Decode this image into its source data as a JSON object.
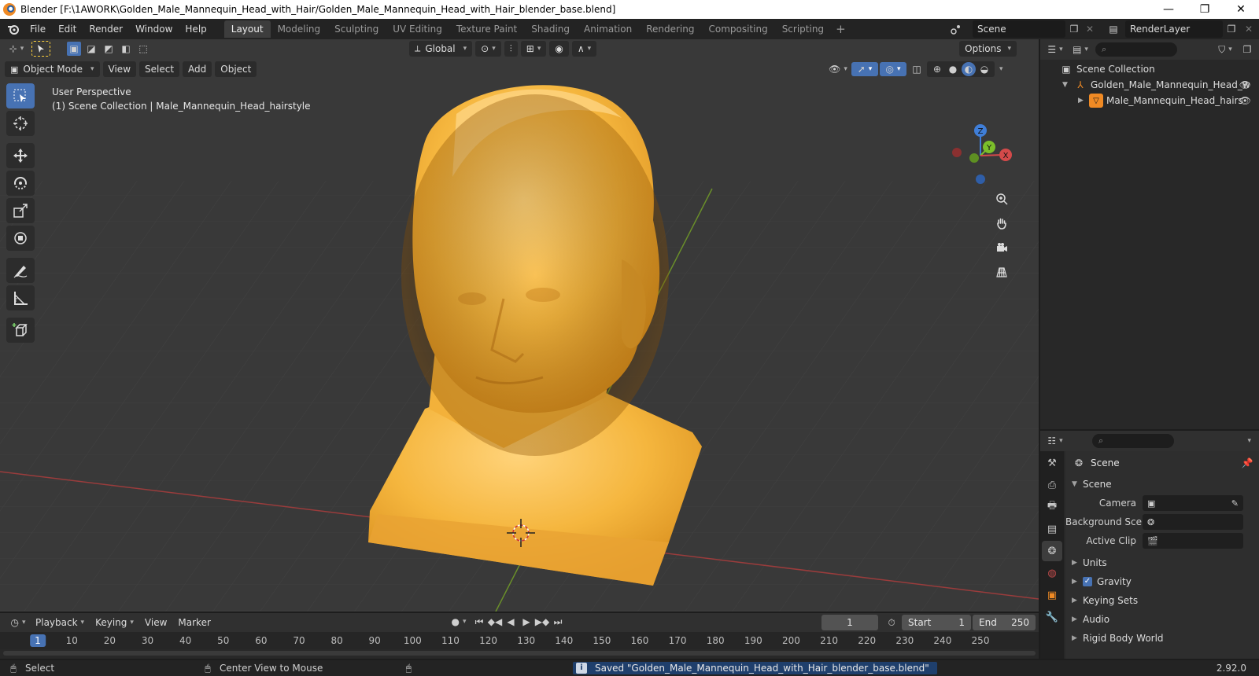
{
  "window": {
    "title": "Blender [F:\\1AWORK\\Golden_Male_Mannequin_Head_with_Hair/Golden_Male_Mannequin_Head_with_Hair_blender_base.blend]",
    "minimize": "—",
    "restore": "❐",
    "close": "✕"
  },
  "topbar": {
    "menus": [
      "File",
      "Edit",
      "Render",
      "Window",
      "Help"
    ],
    "workspaces": [
      "Layout",
      "Modeling",
      "Sculpting",
      "UV Editing",
      "Texture Paint",
      "Shading",
      "Animation",
      "Rendering",
      "Compositing",
      "Scripting"
    ],
    "active_workspace": "Layout",
    "add_workspace": "+",
    "scene_name": "Scene",
    "view_layer": "RenderLayer"
  },
  "viewport": {
    "mode": "Object Mode",
    "menus": [
      "View",
      "Select",
      "Add",
      "Object"
    ],
    "transform_orientation": "Global",
    "options_label": "Options",
    "perspective": "User Perspective",
    "collection_info": "(1) Scene Collection | Male_Mannequin_Head_hairstyle",
    "gizmo": {
      "z": "Z",
      "y": "Y",
      "x": "X"
    },
    "colors": {
      "background": "#393939",
      "x_axis": "#d44a4a",
      "y_axis": "#7bbf2a",
      "mesh": "#f2b43c",
      "selection": "#4772b3"
    }
  },
  "outliner": {
    "search_placeholder": "⌕",
    "root": "Scene Collection",
    "items": [
      {
        "label": "Golden_Male_Mannequin_Head_w"
      },
      {
        "label": "Male_Mannequin_Head_hairs"
      }
    ]
  },
  "properties": {
    "search_placeholder": "⌕",
    "context": "Scene",
    "scene_panel": "Scene",
    "fields": [
      {
        "label": "Camera",
        "value": ""
      },
      {
        "label": "Background Sce...",
        "value": ""
      },
      {
        "label": "Active Clip",
        "value": ""
      }
    ],
    "panels": [
      "Units",
      "Gravity",
      "Keying Sets",
      "Audio",
      "Rigid Body World"
    ],
    "gravity_checked": "✓"
  },
  "timeline": {
    "menus": [
      "Playback",
      "Keying",
      "View",
      "Marker"
    ],
    "current_frame": "1",
    "start_label": "Start",
    "start": "1",
    "end_label": "End",
    "end": "250",
    "ruler": [
      "1",
      "10",
      "20",
      "30",
      "40",
      "50",
      "60",
      "70",
      "80",
      "90",
      "100",
      "110",
      "120",
      "130",
      "140",
      "150",
      "160",
      "170",
      "180",
      "190",
      "200",
      "210",
      "220",
      "230",
      "240",
      "250"
    ]
  },
  "statusbar": {
    "left": "Select",
    "middle": "Center View to Mouse",
    "message": "Saved \"Golden_Male_Mannequin_Head_with_Hair_blender_base.blend\"",
    "version": "2.92.0"
  }
}
